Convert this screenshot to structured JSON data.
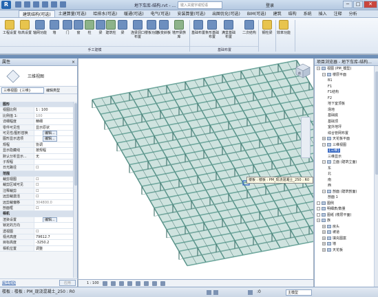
{
  "title": {
    "app_logo": "R",
    "document": "地下车库-结构.rvt - ...",
    "search_placeholder": "键入关键字或短语",
    "user": "登录",
    "window_buttons": [
      "−",
      "□",
      "✕"
    ]
  },
  "tabs": [
    "建筑结构(可选)",
    "土建算量(可选)",
    "给排水(可选)",
    "暖通(可选)",
    "电气(可选)",
    "安装算量(可选)",
    "出图优化(可选)",
    "BIM(可选)",
    "建筑",
    "结构",
    "系统",
    "插入",
    "注释",
    "分析"
  ],
  "active_tab": 0,
  "ribbon": {
    "buttons": [
      "工程设置",
      "标高设置",
      "轴网功能",
      "墙",
      "门",
      "窗",
      "柱",
      "梁",
      "建筑柱",
      "梁",
      "连梁洞口布置",
      "楼板功能",
      "板变斜板",
      "墙开梁族库",
      "基础布置",
      "条形基础布置",
      "满堂基础布置",
      "二次结构",
      "钢柱梁",
      "效率功能"
    ],
    "groups": [
      "手工建模",
      "基础布置"
    ]
  },
  "properties": {
    "header": "属性",
    "close": "×",
    "type_label": "三维视图",
    "selector": "三维视图: {三维}",
    "edit_type": "编辑类型",
    "rows": [
      {
        "k": "图形",
        "v": "",
        "sec": true
      },
      {
        "k": "视图比例",
        "v": "1 : 100"
      },
      {
        "k": "比例值 1:",
        "v": "100",
        "dim": true
      },
      {
        "k": "详细程度",
        "v": "精细"
      },
      {
        "k": "零件可见性",
        "v": "显示原状"
      },
      {
        "k": "可见性/图形替换",
        "v": "编辑...",
        "btn": true
      },
      {
        "k": "图形显示选项",
        "v": "编辑...",
        "btn": true
      },
      {
        "k": "规程",
        "v": "协调"
      },
      {
        "k": "显示隐藏线",
        "v": "按规程"
      },
      {
        "k": "默认分析显示...",
        "v": "无"
      },
      {
        "k": "子规程",
        "v": ""
      },
      {
        "k": "日光路径",
        "v": "☐"
      },
      {
        "k": "范围",
        "v": "",
        "sec": true
      },
      {
        "k": "裁剪视图",
        "v": "☐"
      },
      {
        "k": "裁剪区域可见",
        "v": "☐"
      },
      {
        "k": "注释裁剪",
        "v": "☐"
      },
      {
        "k": "远剪裁激活",
        "v": "☐"
      },
      {
        "k": "远剪裁偏移",
        "v": "304800.0",
        "dim": true
      },
      {
        "k": "剖面框",
        "v": "☐"
      },
      {
        "k": "相机",
        "v": "",
        "sec": true
      },
      {
        "k": "渲染设置",
        "v": "编辑...",
        "btn": true
      },
      {
        "k": "锁定的方向",
        "v": "",
        "dim": true
      },
      {
        "k": "透视图",
        "v": "☐"
      },
      {
        "k": "视点高度",
        "v": "79612.7"
      },
      {
        "k": "目标高度",
        "v": "-3250.2"
      },
      {
        "k": "相机位置",
        "v": "调整"
      }
    ],
    "help": "属性帮助",
    "apply": "应用"
  },
  "viewport": {
    "tooltip": "楼板 : 楼板 : PM_现浇混凝土_250 : R0",
    "cube": "前",
    "scale": "1 : 100"
  },
  "browser": {
    "header": "项目浏览器 - 地下车库-结构...",
    "items": [
      {
        "t": "视图 (PM_模型)",
        "lv": 0,
        "exp": "−"
      },
      {
        "t": "楼层平面",
        "lv": 1,
        "exp": "−"
      },
      {
        "t": "B1",
        "lv": 2
      },
      {
        "t": "F1",
        "lv": 2
      },
      {
        "t": "F1结构",
        "lv": 2
      },
      {
        "t": "F2",
        "lv": 2
      },
      {
        "t": "地下室顶板",
        "lv": 2
      },
      {
        "t": "场地",
        "lv": 2
      },
      {
        "t": "基础底",
        "lv": 2
      },
      {
        "t": "基础顶",
        "lv": 2
      },
      {
        "t": "室外地坪",
        "lv": 2
      },
      {
        "t": "综合管网布置",
        "lv": 2
      },
      {
        "t": "天花板平面",
        "lv": 1,
        "exp": "+"
      },
      {
        "t": "三维视图",
        "lv": 1,
        "exp": "−"
      },
      {
        "t": "{三维}",
        "lv": 2,
        "sel": true
      },
      {
        "t": "三维显示",
        "lv": 2
      },
      {
        "t": "立面 (建筑立面)",
        "lv": 1,
        "exp": "−"
      },
      {
        "t": "东",
        "lv": 2
      },
      {
        "t": "北",
        "lv": 2
      },
      {
        "t": "南",
        "lv": 2
      },
      {
        "t": "西",
        "lv": 2
      },
      {
        "t": "剖面 (建筑剖面)",
        "lv": 1,
        "exp": "−"
      },
      {
        "t": "剖面 1",
        "lv": 2
      },
      {
        "t": "图例",
        "lv": 0,
        "exp": ""
      },
      {
        "t": "明细表/数量",
        "lv": 0,
        "exp": ""
      },
      {
        "t": "图纸 (楼层平面)",
        "lv": 0,
        "exp": ""
      },
      {
        "t": "族",
        "lv": 0,
        "exp": "−"
      },
      {
        "t": "房头",
        "lv": 1,
        "exp": "+"
      },
      {
        "t": "坡道",
        "lv": 1,
        "exp": "+"
      },
      {
        "t": "填充图案",
        "lv": 1,
        "exp": "+"
      },
      {
        "t": "墙",
        "lv": 1,
        "exp": "+"
      },
      {
        "t": "天花板",
        "lv": 1,
        "exp": "+"
      }
    ]
  },
  "status": {
    "message": "楼板 : 楼板 : PM_现浇混凝土_250 : R0",
    "zero": ":0",
    "model": "主模型"
  },
  "colors": {
    "structure": "#6fa89e",
    "structure_dark": "#3e6f69",
    "select": "#3c6cc4"
  }
}
